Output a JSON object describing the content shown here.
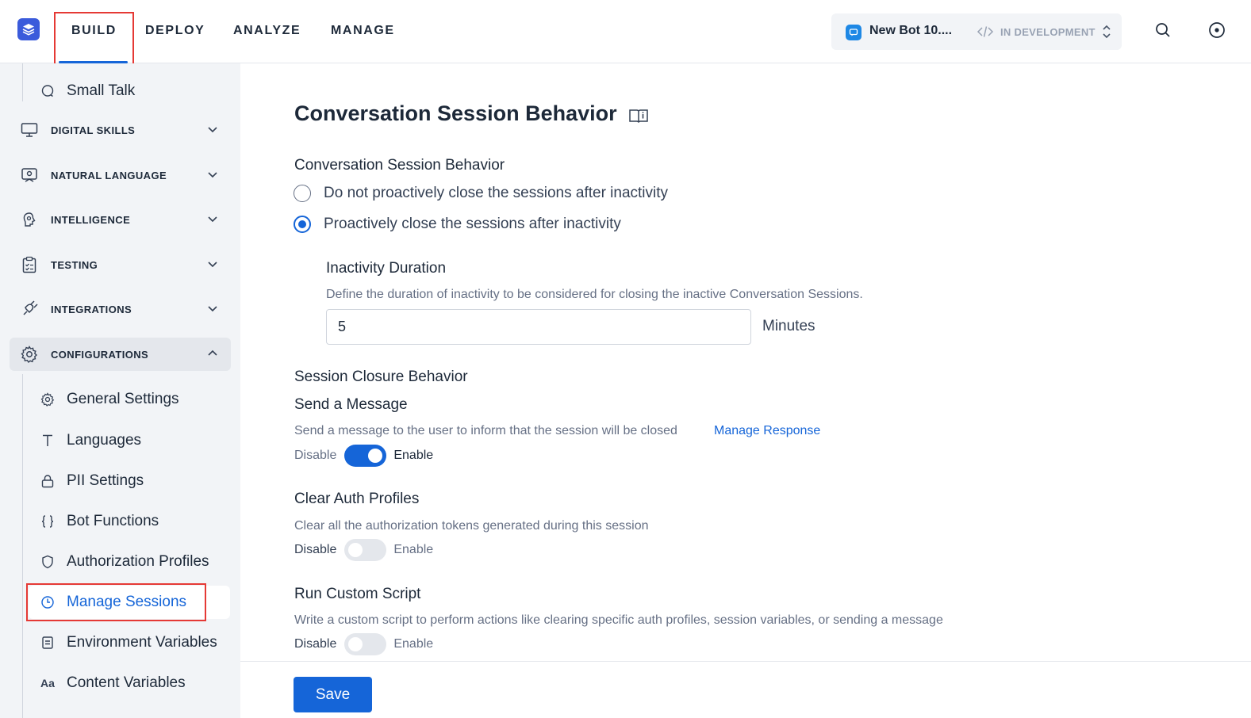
{
  "topnav": {
    "tabs": [
      "BUILD",
      "DEPLOY",
      "ANALYZE",
      "MANAGE"
    ],
    "bot_name": "New Bot 10....",
    "bot_status": "IN DEVELOPMENT"
  },
  "sidebar": {
    "top_sub_item": "Small Talk",
    "groups": {
      "digital_skills": "DIGITAL SKILLS",
      "natural_language": "NATURAL LANGUAGE",
      "intelligence": "INTELLIGENCE",
      "testing": "TESTING",
      "integrations": "INTEGRATIONS",
      "configurations": "CONFIGURATIONS"
    },
    "config_items": {
      "general_settings": "General Settings",
      "languages": "Languages",
      "pii_settings": "PII Settings",
      "bot_functions": "Bot Functions",
      "authorization_profiles": "Authorization Profiles",
      "manage_sessions": "Manage Sessions",
      "environment_variables": "Environment Variables",
      "content_variables": "Content Variables"
    },
    "content_variables_icon_text": "Aa"
  },
  "main": {
    "page_title": "Conversation Session Behavior",
    "behavior_label": "Conversation Session Behavior",
    "radio_options": [
      "Do not proactively close the sessions after inactivity",
      "Proactively close the sessions after inactivity"
    ],
    "selected_radio": 1,
    "inactivity": {
      "title": "Inactivity Duration",
      "description": "Define the duration of inactivity to be considered for closing the inactive Conversation Sessions.",
      "value": "5",
      "units": "Minutes"
    },
    "closure_label": "Session Closure Behavior",
    "send_message": {
      "title": "Send a Message",
      "description": "Send a message to the user to inform that the session will be closed",
      "link": "Manage Response",
      "enabled": true
    },
    "clear_auth": {
      "title": "Clear Auth Profiles",
      "description": "Clear all the authorization tokens generated during this session",
      "enabled": false
    },
    "custom_script": {
      "title": "Run Custom Script",
      "description": "Write a custom script to perform actions like clearing specific auth profiles, session variables, or sending a message",
      "enabled": false
    },
    "toggle_labels": {
      "disable": "Disable",
      "enable": "Enable"
    }
  },
  "footer": {
    "save_label": "Save"
  },
  "colors": {
    "accent": "#1565d8",
    "highlight": "#e53935",
    "sidebar_bg": "#f2f4f7"
  }
}
